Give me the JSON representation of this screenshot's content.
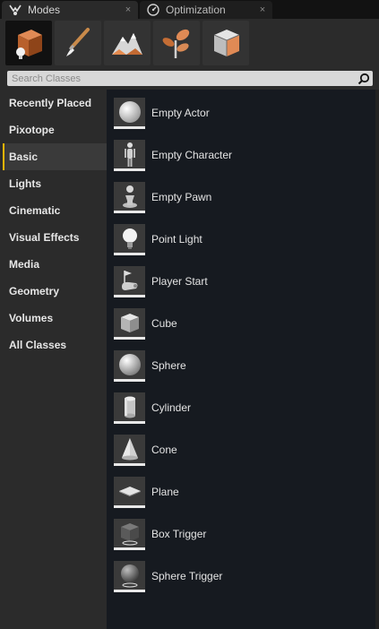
{
  "tabs": [
    {
      "label": "Modes",
      "icon": "modes-icon",
      "close": "×"
    },
    {
      "label": "Optimization",
      "icon": "optimization-icon",
      "close": "×"
    }
  ],
  "modes": [
    {
      "name": "place",
      "icon": "place-mode-icon",
      "active": true
    },
    {
      "name": "paint",
      "icon": "paint-mode-icon",
      "active": false
    },
    {
      "name": "landscape",
      "icon": "landscape-mode-icon",
      "active": false
    },
    {
      "name": "foliage",
      "icon": "foliage-mode-icon",
      "active": false
    },
    {
      "name": "geometry",
      "icon": "geometry-mode-icon",
      "active": false
    }
  ],
  "search": {
    "placeholder": "Search Classes",
    "value": ""
  },
  "categories": [
    {
      "label": "Recently Placed"
    },
    {
      "label": "Pixotope"
    },
    {
      "label": "Basic",
      "active": true
    },
    {
      "label": "Lights"
    },
    {
      "label": "Cinematic"
    },
    {
      "label": "Visual Effects"
    },
    {
      "label": "Media"
    },
    {
      "label": "Geometry"
    },
    {
      "label": "Volumes"
    },
    {
      "label": "All Classes"
    }
  ],
  "classes": [
    {
      "label": "Empty Actor",
      "icon": "empty-actor-icon"
    },
    {
      "label": "Empty Character",
      "icon": "empty-character-icon"
    },
    {
      "label": "Empty Pawn",
      "icon": "empty-pawn-icon"
    },
    {
      "label": "Point Light",
      "icon": "point-light-icon"
    },
    {
      "label": "Player Start",
      "icon": "player-start-icon"
    },
    {
      "label": "Cube",
      "icon": "cube-icon"
    },
    {
      "label": "Sphere",
      "icon": "sphere-icon"
    },
    {
      "label": "Cylinder",
      "icon": "cylinder-icon"
    },
    {
      "label": "Cone",
      "icon": "cone-icon"
    },
    {
      "label": "Plane",
      "icon": "plane-icon"
    },
    {
      "label": "Box Trigger",
      "icon": "box-trigger-icon"
    },
    {
      "label": "Sphere Trigger",
      "icon": "sphere-trigger-icon"
    }
  ],
  "colors": {
    "accent": "#f0b400",
    "panel": "#2b2b2b",
    "list_bg": "#161a20"
  }
}
